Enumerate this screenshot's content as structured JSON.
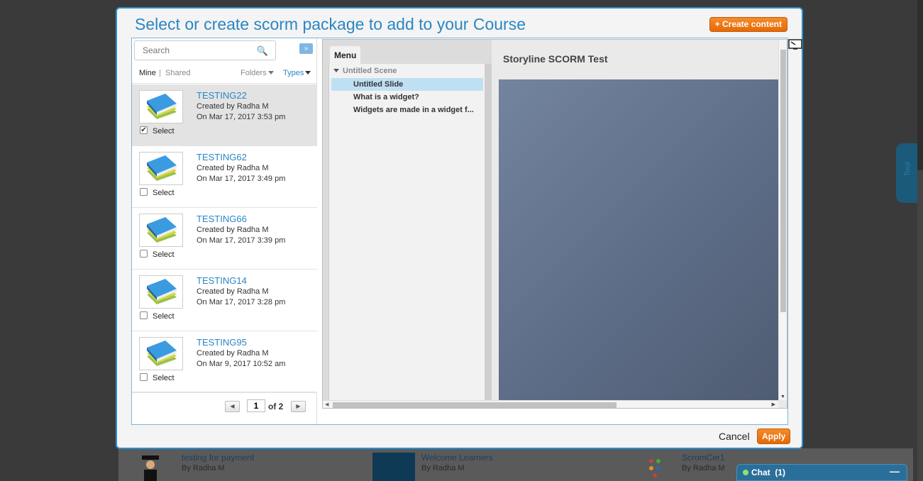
{
  "modal": {
    "title": "Select or create scorm package to add to your Course",
    "create_label": "+ Create content",
    "cancel_label": "Cancel",
    "apply_label": "Apply"
  },
  "search": {
    "placeholder": "Search",
    "icon": "search-icon"
  },
  "filters": {
    "mine": "Mine",
    "separator": "|",
    "shared": "Shared",
    "folders": "Folders",
    "types": "Types"
  },
  "items": [
    {
      "title": "TESTING22",
      "created_by": "Created by Radha M",
      "on": "On Mar 17, 2017 3:53 pm",
      "select": "Select",
      "checked": true
    },
    {
      "title": "TESTING62",
      "created_by": "Created by Radha M",
      "on": "On Mar 17, 2017 3:49 pm",
      "select": "Select",
      "checked": false
    },
    {
      "title": "TESTING66",
      "created_by": "Created by Radha M",
      "on": "On Mar 17, 2017 3:39 pm",
      "select": "Select",
      "checked": false
    },
    {
      "title": "TESTING14",
      "created_by": "Created by Radha M",
      "on": "On Mar 17, 2017 3:28 pm",
      "select": "Select",
      "checked": false
    },
    {
      "title": "TESTING95",
      "created_by": "Created by Radha M",
      "on": "On Mar 9, 2017 10:52 am",
      "select": "Select",
      "checked": false
    }
  ],
  "pager": {
    "page": "1",
    "of": "of 2"
  },
  "preview": {
    "menu_tab": "Menu",
    "scene": "Untitled Scene",
    "slides": [
      "Untitled Slide",
      "What is a widget?",
      "Widgets are made in a widget f..."
    ],
    "active_slide": 0,
    "stage_title": "Storyline SCORM Test"
  },
  "background": {
    "items": [
      {
        "title": "testing for payment",
        "by": "By Radha M"
      },
      {
        "title": "Welcome Learners",
        "by": "By Radha M"
      },
      {
        "title": "ScromCer1",
        "by": "By Radha M"
      }
    ],
    "tour": "Tour"
  },
  "chat": {
    "label": "Chat",
    "count": "(1)"
  },
  "colors": {
    "accent": "#2a86c4",
    "button_orange": "#e46a06",
    "selected_slide": "#bfe0f2"
  }
}
